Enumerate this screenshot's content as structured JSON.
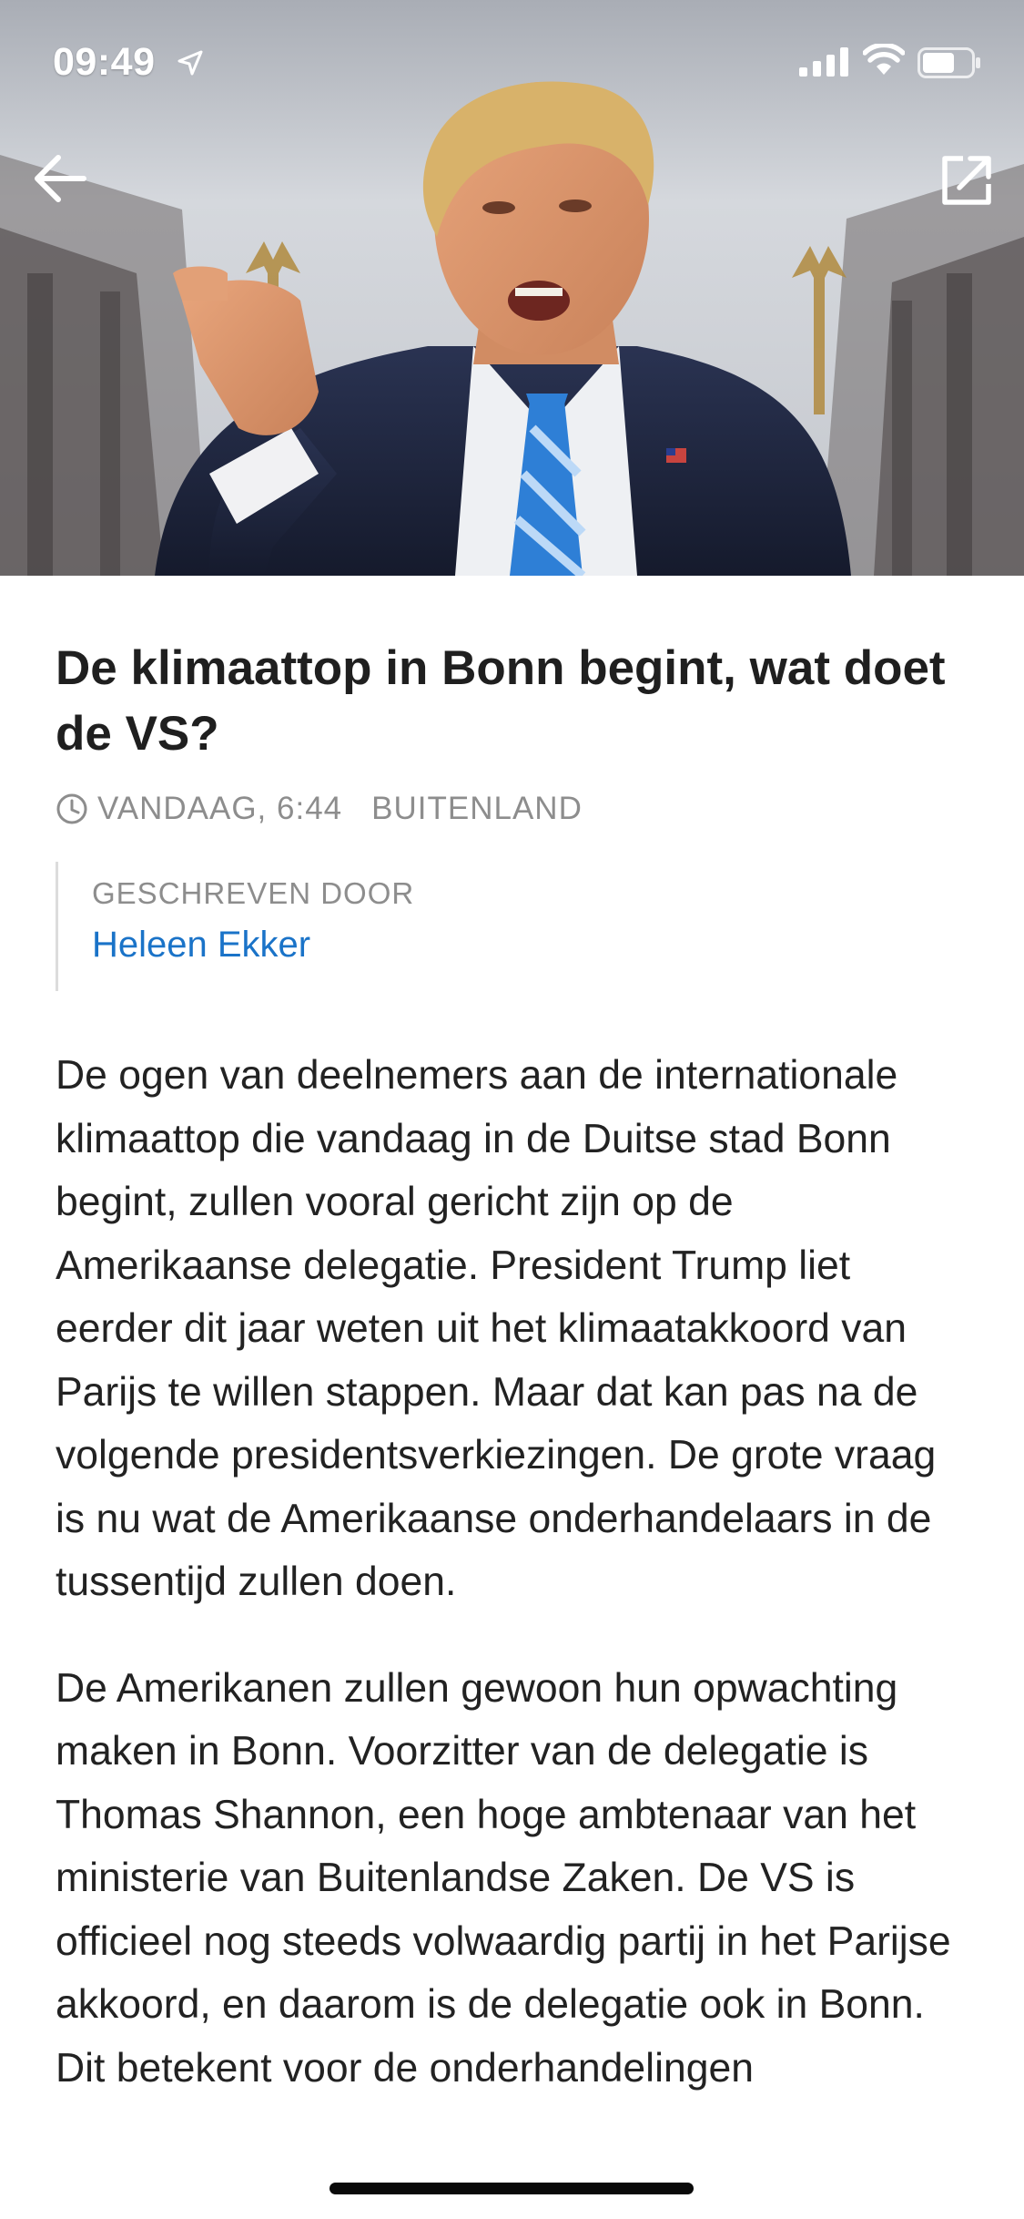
{
  "status_bar": {
    "time": "09:49",
    "location_icon": "location-arrow-icon",
    "signal_icon": "cellular-signal-icon",
    "wifi_icon": "wifi-icon",
    "battery_icon": "battery-icon"
  },
  "navigation": {
    "back_icon": "back-arrow-icon",
    "share_icon": "share-external-icon"
  },
  "hero": {
    "icon": "hero-photo"
  },
  "article": {
    "headline": "De klimaattop in Bonn begint, wat doet de VS?",
    "timestamp": "VANDAAG, 6:44",
    "category": "BUITENLAND",
    "author_label": "GESCHREVEN DOOR",
    "author_name": "Heleen Ekker",
    "paragraphs": [
      "De ogen van deelnemers aan de internationale klimaattop die vandaag in de Duitse stad Bonn begint, zullen vooral gericht zijn op de Amerikaanse delegatie. President Trump liet eerder dit jaar weten uit het klimaatakkoord van Parijs te willen stappen. Maar dat kan pas na de volgende presidentsverkiezingen. De grote vraag is nu wat de Amerikaanse onderhandelaars in de tussentijd zullen doen.",
      "De Amerikanen zullen gewoon hun opwachting maken in Bonn. Voorzitter van de delegatie is Thomas Shannon, een hoge ambtenaar van het ministerie van Buitenlandse Zaken. De VS is officieel nog steeds volwaardig partij in het Parijse akkoord, en daarom is de delegatie ook in Bonn. Dit betekent voor de onderhandelingen"
    ]
  },
  "colors": {
    "link": "#1a73c8",
    "meta_gray": "#8d8d8d",
    "text": "#222222"
  }
}
